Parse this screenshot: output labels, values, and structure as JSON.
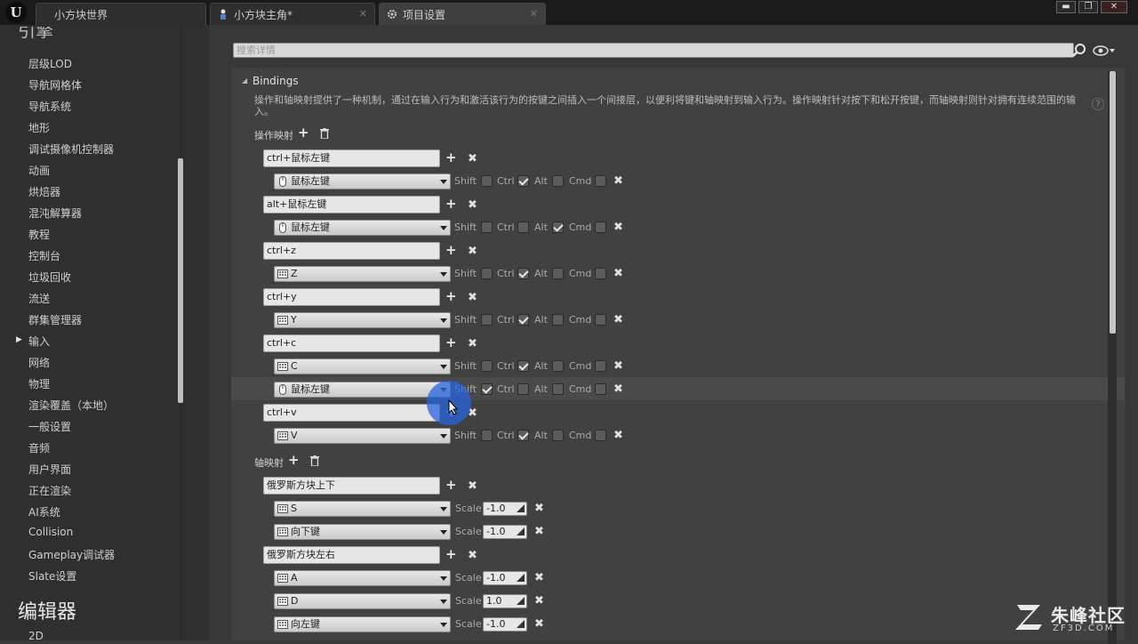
{
  "tabs": [
    {
      "label": "小方块世界",
      "icon": "level-icon"
    },
    {
      "label": "小方块主角*",
      "icon": "blueprint-icon"
    },
    {
      "label": "项目设置",
      "icon": "gear-icon"
    }
  ],
  "window_controls": {
    "minimize": "▬",
    "maximize": "❐",
    "close": "✕"
  },
  "sidebar": {
    "top_header_partial": "引擎",
    "items": [
      "层级LOD",
      "导航网格体",
      "导航系统",
      "地形",
      "调试摄像机控制器",
      "动画",
      "烘焙器",
      "混沌解算器",
      "教程",
      "控制台",
      "垃圾回收",
      "流送",
      "群集管理器",
      "输入",
      "网络",
      "物理",
      "渲染覆盖（本地）",
      "一般设置",
      "音频",
      "用户界面",
      "正在渲染",
      "AI系统",
      "Collision",
      "Gameplay调试器",
      "Slate设置"
    ],
    "selected": "输入",
    "editor_header": "编辑器",
    "editor_first_item": "2D"
  },
  "search": {
    "placeholder": "搜索详情"
  },
  "bindings": {
    "title": "Bindings",
    "description": "操作和轴映射提供了一种机制，通过在输入行为和激活该行为的按键之间插入一个间接层，以便利将键和轴映射到输入行为。操作映射针对按下和松开按键，而轴映射则针对拥有连续范围的输入。",
    "action_mappings_label": "操作映射",
    "axis_mappings_label": "轴映射",
    "modifiers": {
      "shift": "Shift",
      "ctrl": "Ctrl",
      "alt": "Alt",
      "cmd": "Cmd"
    },
    "scale_label": "Scale",
    "actions": [
      {
        "name": "ctrl+鼠标左键",
        "keys": [
          {
            "key": "鼠标左键",
            "icon": "mouse-icon",
            "shift": false,
            "ctrl": true,
            "alt": false,
            "cmd": false
          }
        ]
      },
      {
        "name": "alt+鼠标左键",
        "keys": [
          {
            "key": "鼠标左键",
            "icon": "mouse-icon",
            "shift": false,
            "ctrl": false,
            "alt": true,
            "cmd": false
          }
        ]
      },
      {
        "name": "ctrl+z",
        "keys": [
          {
            "key": "Z",
            "icon": "keyboard-icon",
            "shift": false,
            "ctrl": true,
            "alt": false,
            "cmd": false
          }
        ]
      },
      {
        "name": "ctrl+y",
        "keys": [
          {
            "key": "Y",
            "icon": "keyboard-icon",
            "shift": false,
            "ctrl": true,
            "alt": false,
            "cmd": false
          }
        ]
      },
      {
        "name": "ctrl+c",
        "keys": [
          {
            "key": "C",
            "icon": "keyboard-icon",
            "shift": false,
            "ctrl": true,
            "alt": false,
            "cmd": false
          },
          {
            "key": "鼠标左键",
            "icon": "mouse-icon",
            "shift": true,
            "ctrl": false,
            "alt": false,
            "cmd": false
          }
        ]
      },
      {
        "name": "ctrl+v",
        "keys": [
          {
            "key": "V",
            "icon": "keyboard-icon",
            "shift": false,
            "ctrl": true,
            "alt": false,
            "cmd": false
          }
        ]
      }
    ],
    "axes": [
      {
        "name": "俄罗斯方块上下",
        "keys": [
          {
            "key": "S",
            "icon": "keyboard-icon",
            "scale": "-1.0"
          },
          {
            "key": "向下键",
            "icon": "keyboard-icon",
            "scale": "-1.0"
          }
        ]
      },
      {
        "name": "俄罗斯方块左右",
        "keys": [
          {
            "key": "A",
            "icon": "keyboard-icon",
            "scale": "-1.0"
          },
          {
            "key": "D",
            "icon": "keyboard-icon",
            "scale": "1.0"
          },
          {
            "key": "向左键",
            "icon": "keyboard-icon",
            "scale": "-1.0"
          }
        ]
      }
    ]
  },
  "watermark": {
    "name": "朱峰社区",
    "url": "ZF3D.COM"
  },
  "colors": {
    "accent_cursor": "#2864dc",
    "panel": "#414141",
    "sidebar": "#2f2f2f"
  }
}
